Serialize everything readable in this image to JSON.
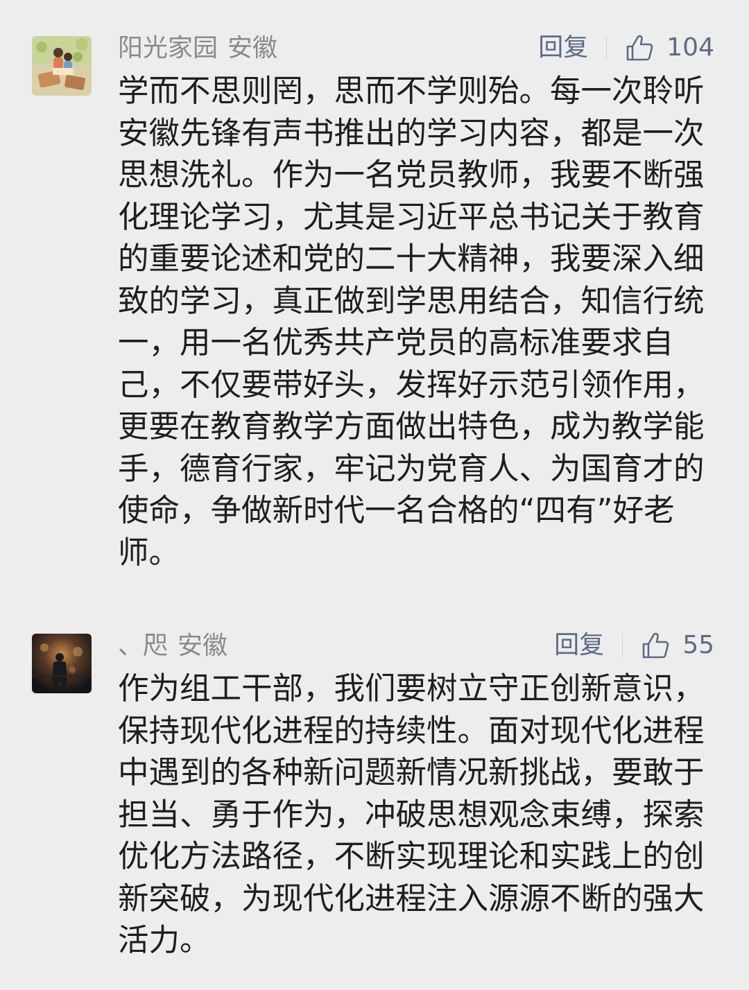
{
  "comments": [
    {
      "username": "阳光家园",
      "region": "安徽",
      "reply_label": "回复",
      "like_count": "104",
      "avatar_icon": "illustrated-family-reading-avatar",
      "text": "学而不思则罔，思而不学则殆。每一次聆听\n安徽先锋有声书推出的学习内容，都是一次\n思想洗礼。作为一名党员教师，我要不断强\n化理论学习，尤其是习近平总书记关于教育\n的重要论述和党的二十大精神，我要深入细\n致的学习，真正做到学思用结合，知信行统\n一，用一名优秀共产党员的高标准要求自\n己，不仅要带好头，发挥好示范引领作用，\n更要在教育教学方面做出特色，成为教学能\n手，德育行家，牢记为党育人、为国育才的\n使命，争做新时代一名合格的“四有”好老\n师。"
    },
    {
      "username": "、咫",
      "region": "安徽",
      "reply_label": "回复",
      "like_count": "55",
      "avatar_icon": "dark-figure-silhouette-avatar",
      "text": "作为组工干部，我们要树立守正创新意识，\n保持现代化进程的持续性。面对现代化进程\n中遇到的各种新问题新情况新挑战，要敢于\n担当、勇于作为，冲破思想观念束缚，探索\n优化方法路径，不断实现理论和实践上的创\n新突破，为现代化进程注入源源不断的强大\n活力。"
    }
  ],
  "colors": {
    "background": "#ededed",
    "username": "#8a8a8a",
    "action": "#5c6b86",
    "body_text": "#1e1e1e"
  }
}
